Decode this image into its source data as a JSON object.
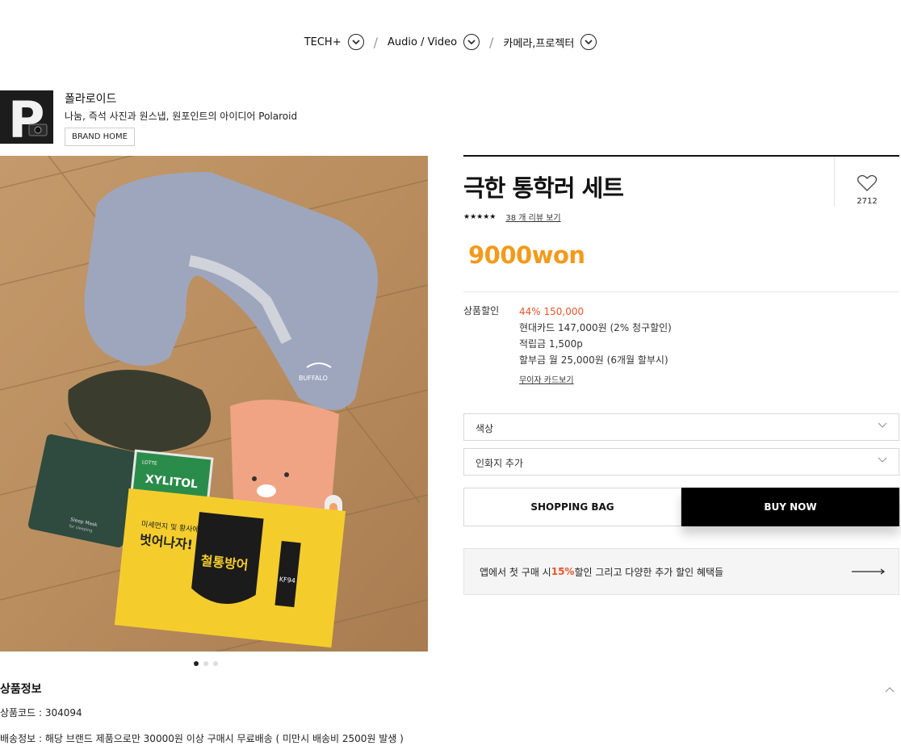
{
  "nav": {
    "crumbs": [
      {
        "label": "TECH+"
      },
      {
        "label": "Audio / Video"
      },
      {
        "label": "카메라,프로젝터"
      }
    ],
    "separator": "/"
  },
  "brand": {
    "logo_letter": "P",
    "name": "폴라로이드",
    "description": "나눔, 즉석 사진과 원스냅, 원포인트의 아이디어 Polaroid",
    "home_button": "BRAND HOME"
  },
  "product": {
    "title": "극한 통학러 세트",
    "wish_count": "2712",
    "stars": "★★★★★",
    "review_link": "38 개 리뷰 보기",
    "price": "9000won",
    "discount": {
      "label": "상품할인",
      "rate_price": "44% 150,000",
      "card": "현대카드 147,000원 (2% 청구할인)",
      "points": "적립금 1,500p",
      "installment": "할부금 월 25,000원 (6개월 할부시)",
      "card_link": "무이자 카드보기"
    },
    "options": {
      "color": "색상",
      "sticker": "인화지 추가"
    },
    "buttons": {
      "bag": "SHOPPING BAG",
      "buy": "BUY NOW"
    },
    "promo": {
      "prefix": "앱에서 첫 구매 시 ",
      "percent": "15%",
      "suffix": " 할인 그리고 다양한 추가 할인 혜택들"
    }
  },
  "image": {
    "pillow_brand": "BUFFALO",
    "gum_brand": "LOTTE",
    "gum_name": "XYLITOL",
    "mask_pouch": "Sleep Mask",
    "mask_pouch_sub": "for sleeping",
    "mask_line1": "미세먼지 및 황사에서",
    "mask_line2": "벗어나자!",
    "mask_grade": "KF94",
    "mask_product": "철통방어"
  },
  "gallery": {
    "dots": 3,
    "active": 0
  },
  "details": {
    "title": "상품정보",
    "code": "상품코드 : 304094",
    "shipping": "배송정보 : 해당 브랜드 제품으로만 30000원 이상 구매시 무료배송 ( 미만시 배송비 2500원 발생 )"
  },
  "colors": {
    "price": "#f39a1b",
    "discount_red": "#e8542c",
    "buy_bg": "#000000"
  }
}
